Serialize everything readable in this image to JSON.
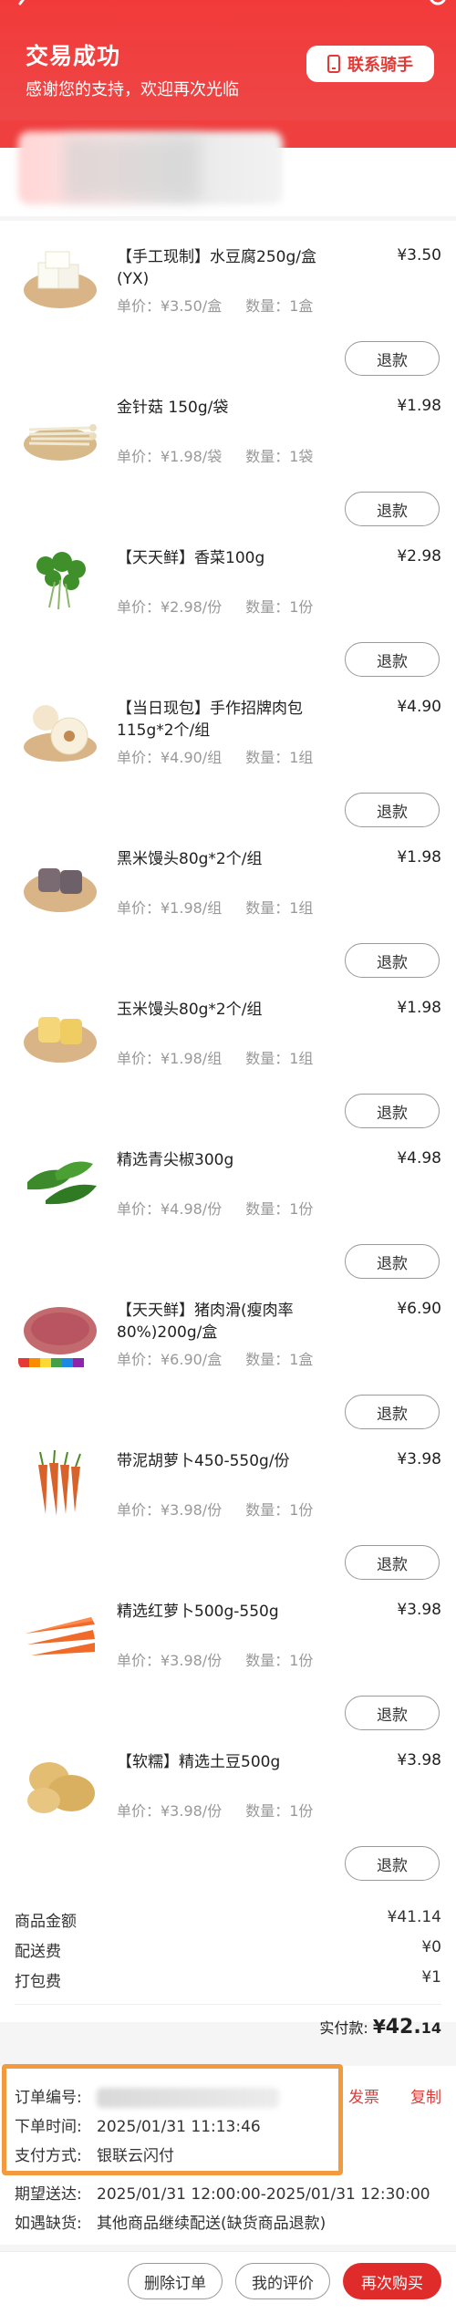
{
  "header": {
    "title": "交易成功",
    "subtitle": "感谢您的支持，欢迎再次光临",
    "contact_rider": "联系骑手"
  },
  "items": [
    {
      "name": "【手工现制】水豆腐250g/盒(YX)",
      "price": "¥3.50",
      "unit_price": "单价：¥3.50/盒",
      "quantity": "数量：1盒",
      "refund": "退款",
      "icon": "tofu-icon"
    },
    {
      "name": "金针菇 150g/袋",
      "price": "¥1.98",
      "unit_price": "单价：¥1.98/袋",
      "quantity": "数量：1袋",
      "refund": "退款",
      "icon": "enoki-icon"
    },
    {
      "name": "【天天鲜】香菜100g",
      "price": "¥2.98",
      "unit_price": "单价：¥2.98/份",
      "quantity": "数量：1份",
      "refund": "退款",
      "icon": "coriander-icon"
    },
    {
      "name": "【当日现包】手作招牌肉包115g*2个/组",
      "price": "¥4.90",
      "unit_price": "单价：¥4.90/组",
      "quantity": "数量：1组",
      "refund": "退款",
      "icon": "bun-icon"
    },
    {
      "name": "黑米馒头80g*2个/组",
      "price": "¥1.98",
      "unit_price": "单价：¥1.98/组",
      "quantity": "数量：1组",
      "refund": "退款",
      "icon": "black-rice-bun-icon"
    },
    {
      "name": "玉米馒头80g*2个/组",
      "price": "¥1.98",
      "unit_price": "单价：¥1.98/组",
      "quantity": "数量：1组",
      "refund": "退款",
      "icon": "corn-bun-icon"
    },
    {
      "name": "精选青尖椒300g",
      "price": "¥4.98",
      "unit_price": "单价：¥4.98/份",
      "quantity": "数量：1份",
      "refund": "退款",
      "icon": "green-pepper-icon"
    },
    {
      "name": "【天天鲜】猪肉滑(瘦肉率80%)200g/盒",
      "price": "¥6.90",
      "unit_price": "单价：¥6.90/盒",
      "quantity": "数量：1盒",
      "refund": "退款",
      "icon": "minced-pork-icon"
    },
    {
      "name": "带泥胡萝卜450-550g/份",
      "price": "¥3.98",
      "unit_price": "单价：¥3.98/份",
      "quantity": "数量：1份",
      "refund": "退款",
      "icon": "muddy-carrot-icon"
    },
    {
      "name": "精选红萝卜500g-550g",
      "price": "¥3.98",
      "unit_price": "单价：¥3.98/份",
      "quantity": "数量：1份",
      "refund": "退款",
      "icon": "carrot-icon"
    },
    {
      "name": "【软糯】精选土豆500g",
      "price": "¥3.98",
      "unit_price": "单价：¥3.98/份",
      "quantity": "数量：1份",
      "refund": "退款",
      "icon": "potato-icon"
    }
  ],
  "fees": {
    "goods_label": "商品金额",
    "goods_value": "¥41.14",
    "delivery_label": "配送费",
    "delivery_value": "¥0",
    "packing_label": "打包费",
    "packing_value": "¥1"
  },
  "total": {
    "label": "实付款:",
    "currency": "¥",
    "integer": "42.",
    "decimal": "14"
  },
  "order": {
    "number_label": "订单编号:",
    "invoice": "发票",
    "copy": "复制",
    "time_label": "下单时间:",
    "time_value": "2025/01/31 11:13:46",
    "payment_label": "支付方式:",
    "payment_value": "银联云闪付",
    "expected_label": "期望送达:",
    "expected_value": "2025/01/31 12:00:00-2025/01/31 12:30:00",
    "shortage_label": "如遇缺货:",
    "shortage_value": "其他商品继续配送(缺货商品退款)"
  },
  "bottom": {
    "delete": "删除订单",
    "review": "我的评价",
    "reorder": "再次购买"
  },
  "colors": {
    "brand_red": "#ef3f3f",
    "highlight_orange": "#f39a3f"
  }
}
